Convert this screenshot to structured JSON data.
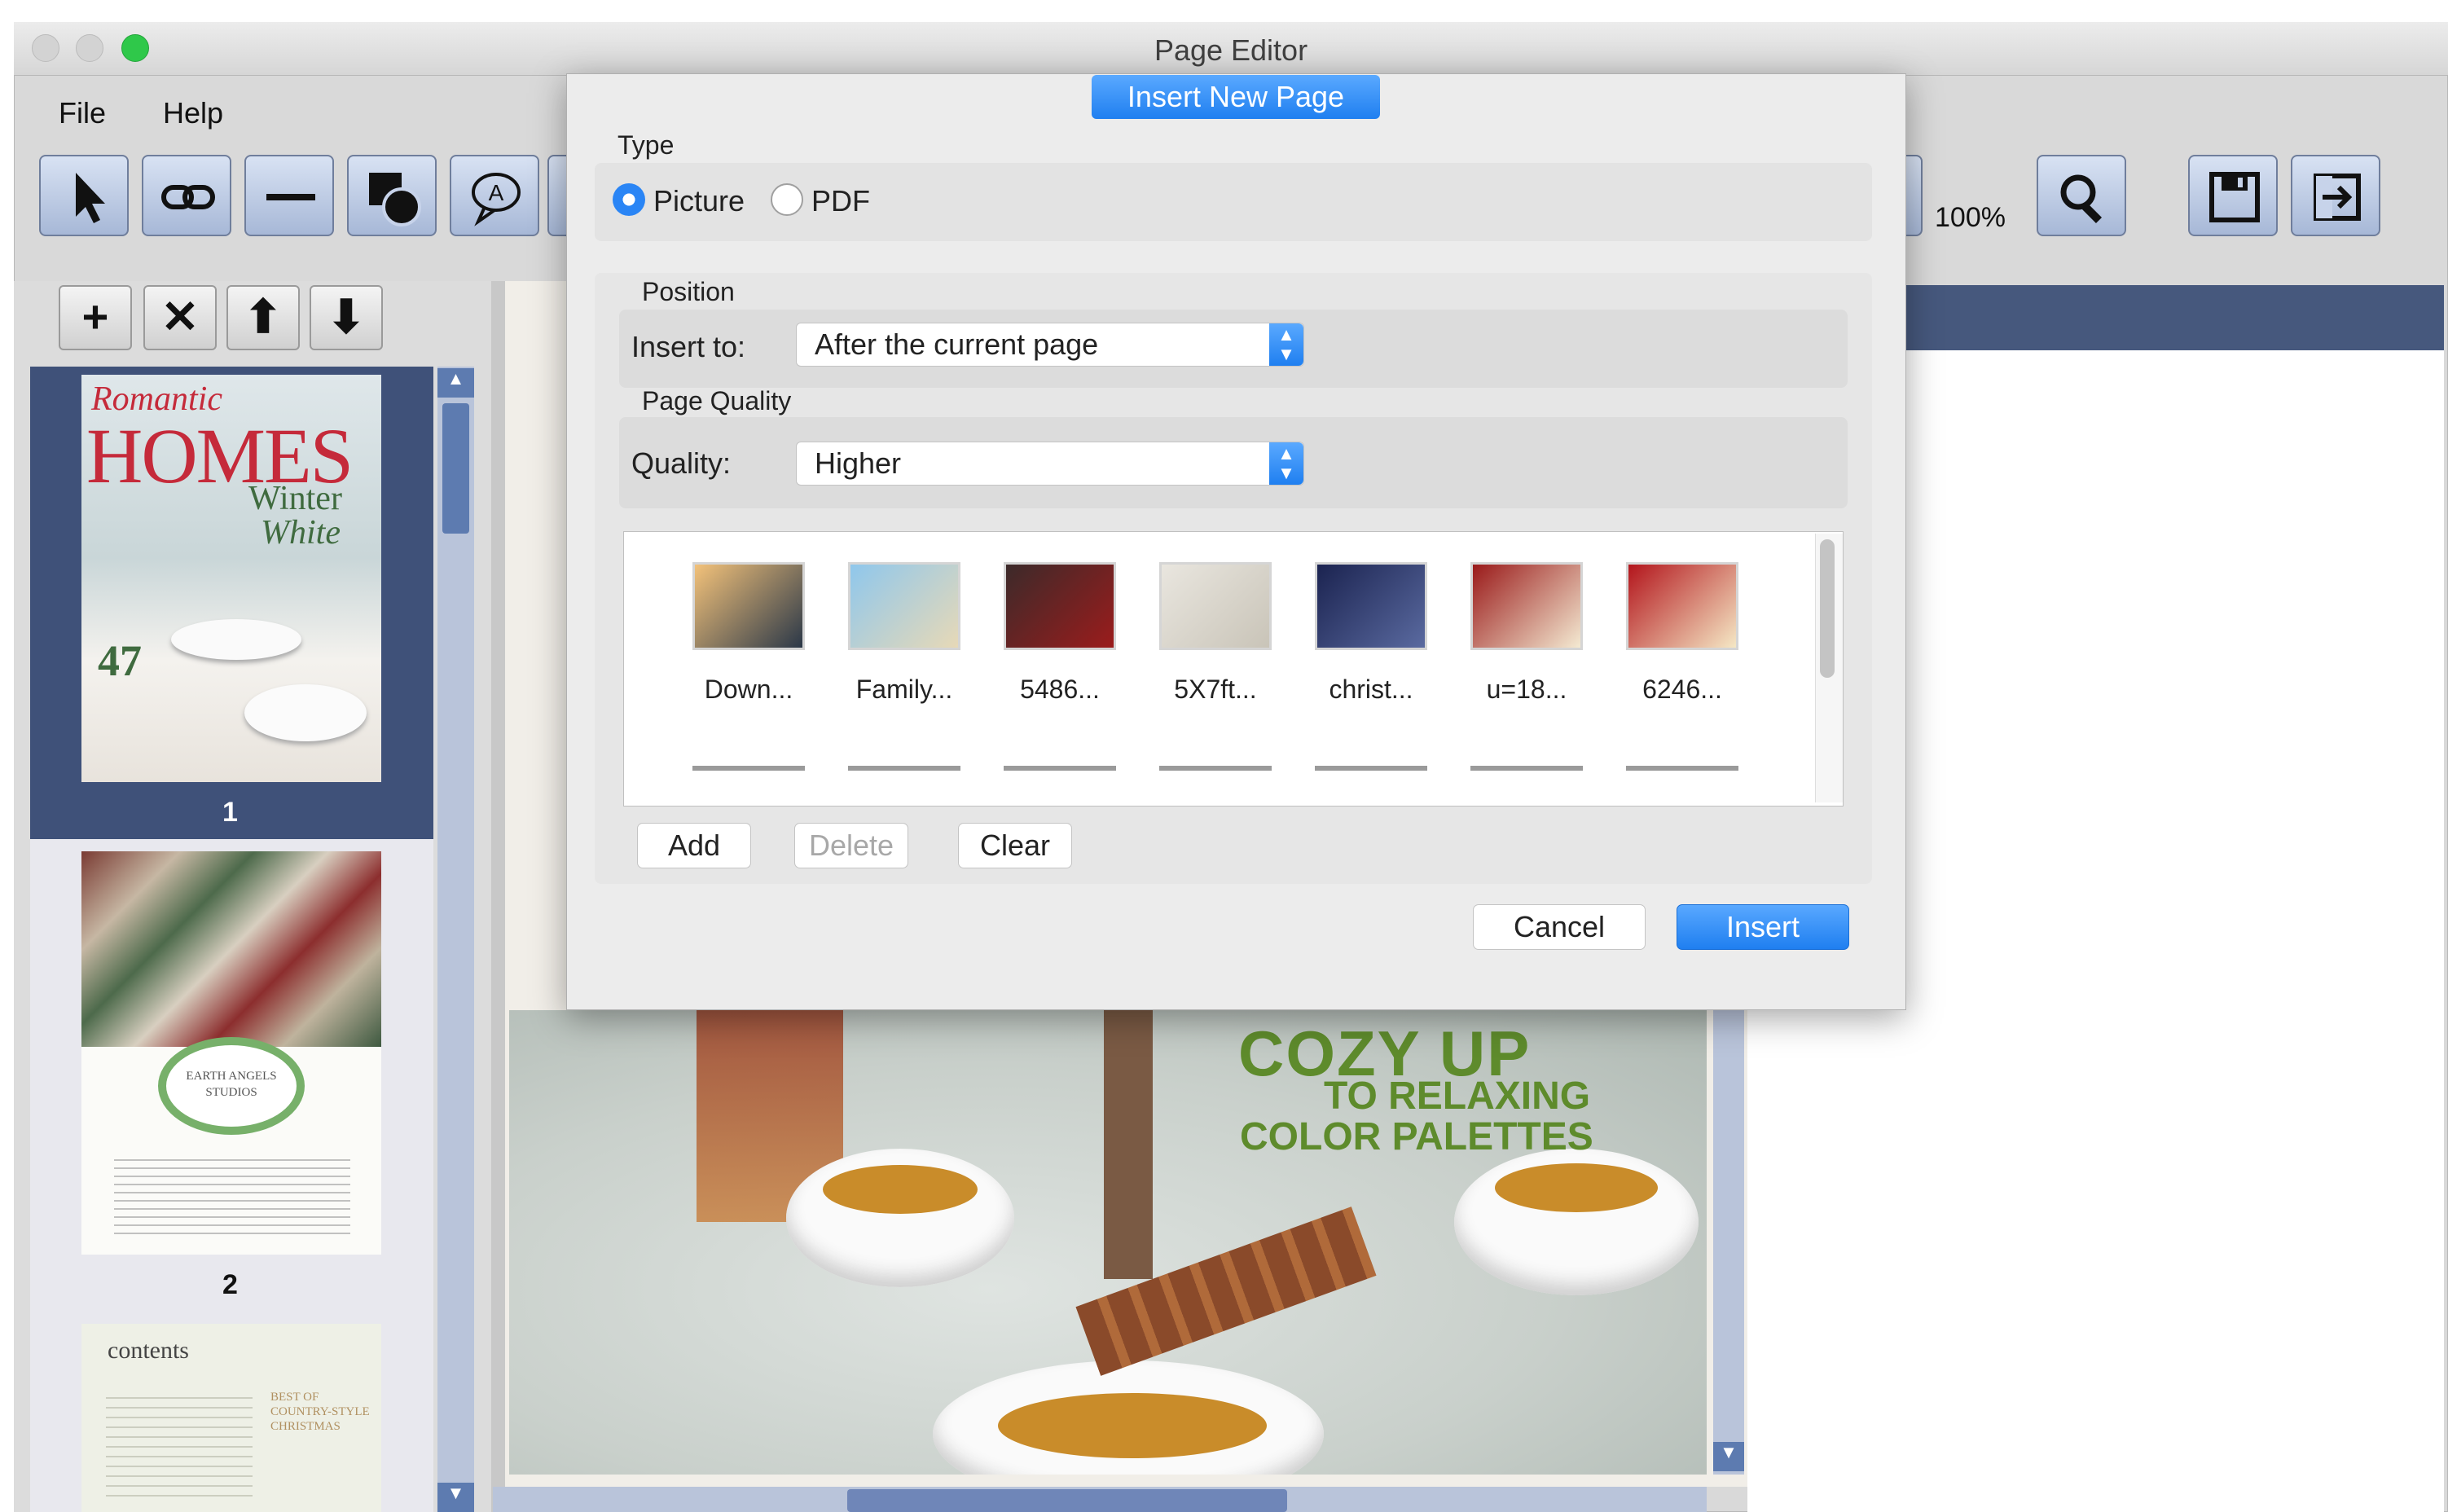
{
  "window": {
    "title": "Page Editor"
  },
  "menu": {
    "file": "File",
    "help": "Help"
  },
  "toolbar": {
    "zoom": "100%"
  },
  "pages_panel": {
    "buttons": {
      "add": "+",
      "remove": "✕",
      "move_up": "⬆",
      "move_down": "⬇"
    },
    "pages": [
      {
        "number": "1",
        "cover": {
          "line1": "Romantic",
          "line2": "HOMES",
          "line3": "Winter",
          "line4": "White",
          "badge": "47"
        }
      },
      {
        "number": "2",
        "cover": {
          "line1": "EARTH ANGELS",
          "line2": "STUDIOS"
        }
      },
      {
        "number": "",
        "cover": {
          "line1": "contents",
          "line2": "BEST OF",
          "line3": "COUNTRY-STYLE",
          "line4": "CHRISTMAS"
        }
      }
    ]
  },
  "page_preview": {
    "headline1": "COZY UP",
    "headline2": "TO RELAXING",
    "headline3": "COLOR PALETTES"
  },
  "dialog": {
    "title": "Insert  New Page",
    "type_label": "Type",
    "type_options": [
      "Picture",
      "PDF"
    ],
    "type_selected": "Picture",
    "position_label": "Position",
    "insert_to_label": "Insert to:",
    "insert_to_value": "After the current page",
    "quality_section_label": "Page Quality",
    "quality_label": "Quality:",
    "quality_value": "Higher",
    "pictures": [
      {
        "name": "Down...",
        "colors": [
          "#f3c27a",
          "#2b3848"
        ]
      },
      {
        "name": "Family...",
        "colors": [
          "#8fc7ec",
          "#e7d9b7"
        ]
      },
      {
        "name": "5486...",
        "colors": [
          "#3c2a2a",
          "#9b1c1c"
        ]
      },
      {
        "name": "5X7ft...",
        "colors": [
          "#e9e6df",
          "#c9c4b8"
        ]
      },
      {
        "name": "christ...",
        "colors": [
          "#1b2350",
          "#5a6aa0"
        ]
      },
      {
        "name": "u=18...",
        "colors": [
          "#9a1a1a",
          "#f4ead2"
        ]
      },
      {
        "name": "6246...",
        "colors": [
          "#b3151c",
          "#f5e8c5"
        ]
      }
    ],
    "buttons": {
      "add": "Add",
      "delete": "Delete",
      "clear": "Clear",
      "cancel": "Cancel",
      "insert": "Insert"
    }
  }
}
